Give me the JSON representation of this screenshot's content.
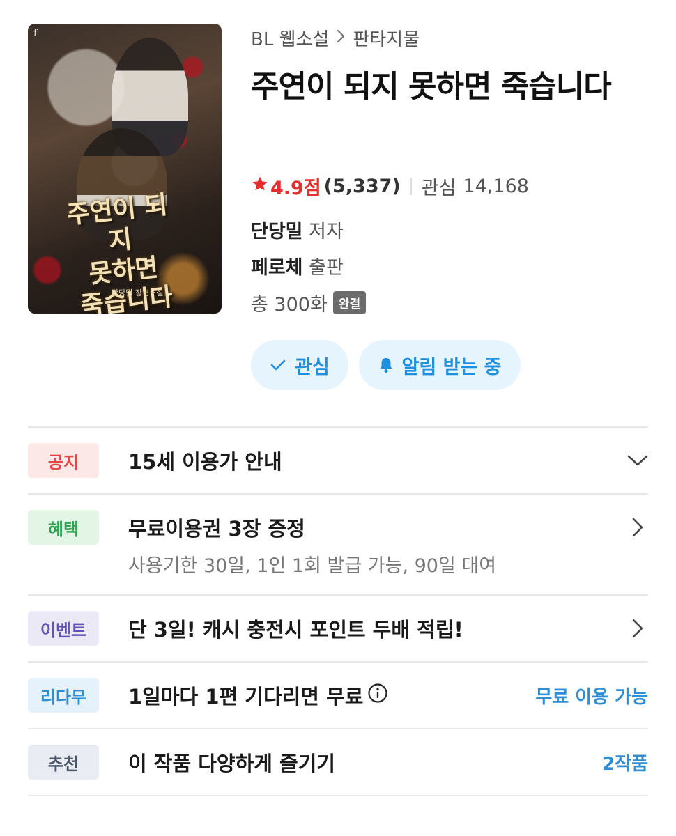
{
  "breadcrumb": [
    "BL 웹소설",
    "판타지물"
  ],
  "title": "주연이 되지 못하면 죽습니다",
  "cover": {
    "title_line1": "주연이 되지",
    "title_line2": "못하면",
    "title_line3": "죽습니다",
    "author": "단당밀 장편소설",
    "logo": "f"
  },
  "rating": {
    "score": "4.9점",
    "count": "(5,337)",
    "interest_label": "관심",
    "interest_count": "14,168"
  },
  "author": {
    "name": "단당밀",
    "role": "저자"
  },
  "publisher": {
    "name": "페로체",
    "role": "출판"
  },
  "episodes": {
    "text": "총 300화",
    "badge": "완결"
  },
  "actions": {
    "interest": "관심",
    "alarm": "알림 받는 중"
  },
  "rows": {
    "notice": {
      "tag": "공지",
      "text": "15세 이용가 안내"
    },
    "benefit": {
      "tag": "혜택",
      "text": "무료이용권 3장 증정",
      "sub": "사용기한 30일, 1인 1회 발급 가능, 90일 대여"
    },
    "event": {
      "tag": "이벤트",
      "text": "단 3일! 캐시 충전시 포인트 두배 적립!"
    },
    "wait": {
      "tag": "리다무",
      "text": "1일마다 1편 기다리면 무료",
      "right": "무료 이용 가능"
    },
    "rec": {
      "tag": "추천",
      "text": "이 작품 다양하게 즐기기",
      "right": "2작품"
    }
  },
  "colors": {
    "accent_blue": "#2f8fd6",
    "rating_red": "#e52e2e",
    "pill_bg": "#e6f4fd"
  },
  "icons": [
    "star-icon",
    "check-icon",
    "bell-icon",
    "chevron-down-icon",
    "chevron-right-icon",
    "info-icon"
  ]
}
